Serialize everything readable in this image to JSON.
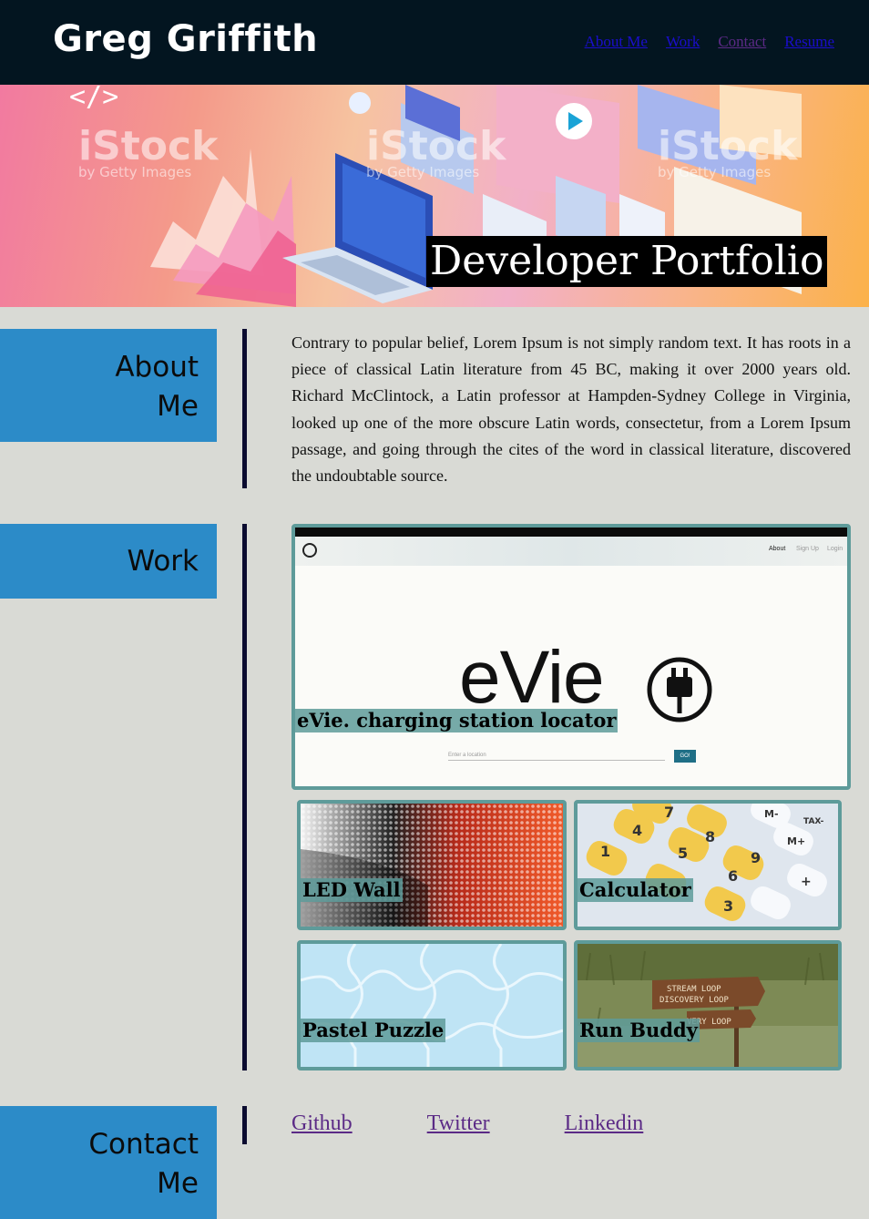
{
  "header": {
    "brand": "Greg Griffith",
    "nav": [
      "About Me",
      "Work",
      "Contact",
      "Resume"
    ]
  },
  "hero": {
    "code_glyph": "</>",
    "watermark": "iStock",
    "watermark_sub": "by Getty Images",
    "title": "Developer Portfolio"
  },
  "about": {
    "tab_line1": "About",
    "tab_line2": "Me",
    "text": "Contrary to popular belief, Lorem Ipsum is not simply random text. It has roots in a piece of classical Latin literature from 45 BC, making it over 2000 years old. Richard McClintock, a Latin professor at Hampden-Sydney College in Virginia, looked up one of the more obscure Latin words, consectetur, from a Lorem Ipsum passage, and going through the cites of the word in classical literature, discovered the undoubtable source."
  },
  "work": {
    "tab": "Work",
    "featured": {
      "label": "eVie. charging station locator",
      "logo_text": "eVie",
      "mock_nav": [
        "About",
        "Sign Up",
        "Login"
      ],
      "mock_input_placeholder": "Enter a location",
      "mock_button": "GO!"
    },
    "projects": [
      {
        "label": "LED Wall"
      },
      {
        "label": "Calculator"
      },
      {
        "label": "Pastel Puzzle"
      },
      {
        "label": "Run Buddy"
      }
    ],
    "calculator_keys": [
      "7",
      "8",
      "9",
      "4",
      "5",
      "6",
      "1",
      "3",
      "M-",
      "M+",
      "TAX-",
      "+"
    ],
    "sign_lines": [
      "STREAM LOOP",
      "DISCOVERY LOOP",
      "VERY LOOP"
    ]
  },
  "contact": {
    "tab_line1": "Contact",
    "tab_line2": "Me",
    "links": [
      "Github",
      "Twitter",
      "Linkedin"
    ]
  },
  "colors": {
    "header_bg": "#031520",
    "tab_bg": "#2c8bc8",
    "card_border": "#5e9b9a",
    "page_bg": "#d9dad5"
  }
}
